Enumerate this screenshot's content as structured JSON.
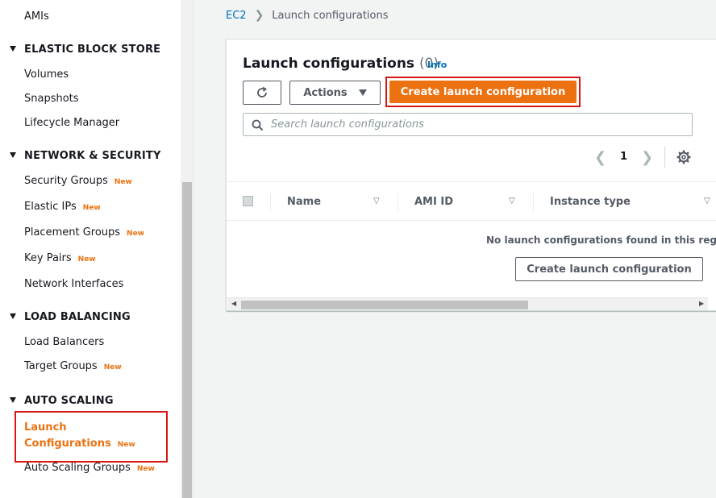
{
  "sidebar": {
    "amis": "AMIs",
    "ebs": {
      "title": "ELASTIC BLOCK STORE",
      "items": [
        "Volumes",
        "Snapshots",
        "Lifecycle Manager"
      ]
    },
    "network": {
      "title": "NETWORK & SECURITY",
      "items": [
        {
          "label": "Security Groups",
          "badge": "New"
        },
        {
          "label": "Elastic IPs",
          "badge": "New"
        },
        {
          "label": "Placement Groups",
          "badge": "New"
        },
        {
          "label": "Key Pairs",
          "badge": "New"
        },
        {
          "label": "Network Interfaces",
          "badge": ""
        }
      ]
    },
    "lb": {
      "title": "LOAD BALANCING",
      "items": [
        {
          "label": "Load Balancers",
          "badge": ""
        },
        {
          "label": "Target Groups",
          "badge": "New"
        }
      ]
    },
    "autoscaling": {
      "title": "AUTO SCALING",
      "items": [
        {
          "label_line1": "Launch",
          "label_line2": "Configurations",
          "badge": "New"
        },
        {
          "label": "Auto Scaling Groups",
          "badge": "New"
        }
      ]
    }
  },
  "breadcrumb": {
    "root": "EC2",
    "current": "Launch configurations"
  },
  "panel": {
    "title": "Launch configurations",
    "count": "(0)",
    "info": "Info",
    "actions_label": "Actions",
    "create_label": "Create launch configuration",
    "search_placeholder": "Search launch configurations",
    "page": "1",
    "columns": [
      "Name",
      "AMI ID",
      "Instance type"
    ],
    "empty_message": "No launch configurations found in this reg",
    "empty_create_label": "Create launch configuration"
  },
  "colors": {
    "accent": "#ec7211",
    "link": "#0073bb",
    "highlight": "#d91515"
  }
}
